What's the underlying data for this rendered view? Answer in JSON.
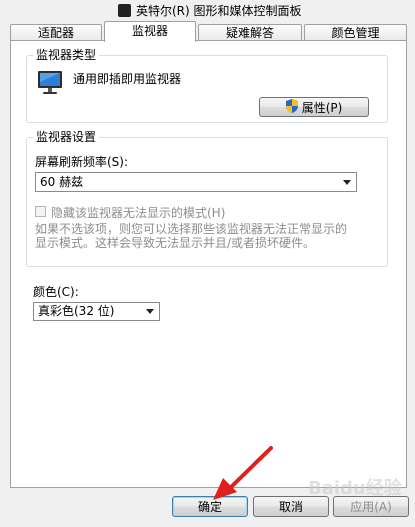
{
  "window": {
    "title": "英特尔(R) 图形和媒体控制面板"
  },
  "tabs": [
    {
      "label": "适配器"
    },
    {
      "label": "监视器"
    },
    {
      "label": "疑难解答"
    },
    {
      "label": "颜色管理"
    }
  ],
  "monitor_type": {
    "legend": "监视器类型",
    "name": "通用即插即用监视器",
    "properties_button": "属性(P)"
  },
  "monitor_settings": {
    "legend": "监视器设置",
    "refresh_label": "屏幕刷新频率(S):",
    "refresh_value": "60 赫兹",
    "hide_modes_label": "隐藏该监视器无法显示的模式(H)",
    "hide_modes_checked": false,
    "description_line1": "如果不选该项，则您可以选择那些该监视器无法正常显示的",
    "description_line2": "显示模式。这样会导致无法显示并且/或者损坏硬件。"
  },
  "color": {
    "label": "颜色(C):",
    "value": "真彩色(32 位)"
  },
  "buttons": {
    "ok": "确定",
    "cancel": "取消",
    "apply": "应用(A)"
  },
  "watermark": "Baidu经验",
  "colors": {
    "annotation_arrow": "#e0201b",
    "focus_border": "#3c7fb1"
  }
}
